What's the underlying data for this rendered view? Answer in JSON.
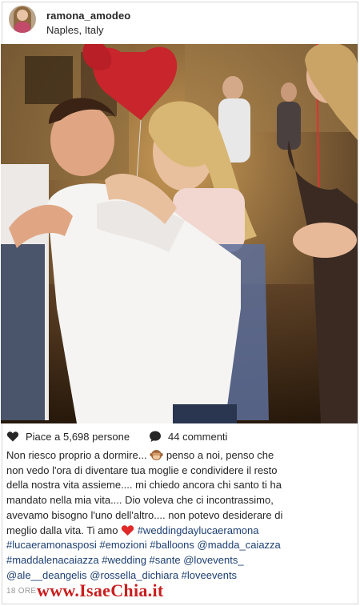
{
  "header": {
    "username": "ramona_amodeo",
    "location": "Naples, Italy"
  },
  "photo": {
    "description_icon": "wedding-celebration-photo"
  },
  "actions": {
    "likes_text": "Piace a 5,698 persone",
    "comments_text": "44 commenti",
    "like_icon": "heart-icon",
    "comment_icon": "comment-bubble-icon"
  },
  "caption": {
    "line1_a": "Non riesco proprio a dormire...",
    "line1_b": " penso a noi, penso che",
    "line2": "non vedo l'ora di diventare tua moglie e condividere il resto",
    "line3": "della nostra vita assieme.... mi chiedo ancora chi santo ti ha",
    "line4": "mandato nella mia vita.... Dio voleva che ci incontrassimo,",
    "line5": "avevamo bisogno l'uno dell'altro.... non potevo desiderare di",
    "line6_a": "meglio dalla vita. Ti amo ",
    "line6_tag": "#weddingdaylucaeramona",
    "line7_tags": [
      "#lucaeramonasposi",
      "#emozioni",
      "#balloons",
      "@madda_caiazza"
    ],
    "line8_tags": [
      "#maddalenacaiazza",
      "#wedding",
      "#sante",
      "@lovevents_"
    ],
    "line9_tags": [
      "@ale__deangelis",
      "@rossella_dichiara",
      "#loveevents"
    ]
  },
  "footer": {
    "time": "18 ORE",
    "watermark": "www.IsaeChia.it"
  },
  "colors": {
    "link": "#1d3f73",
    "watermark": "#c81e1e"
  }
}
